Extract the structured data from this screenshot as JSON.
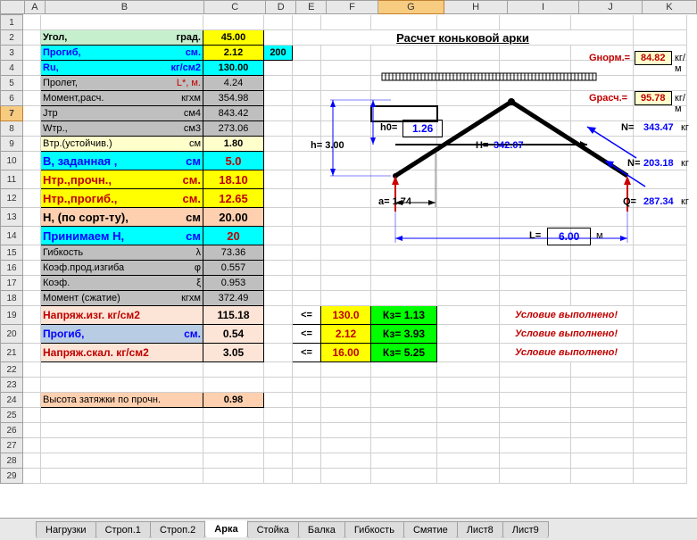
{
  "cols": [
    "A",
    "B",
    "C",
    "D",
    "E",
    "F",
    "G",
    "H",
    "I",
    "J",
    "K"
  ],
  "selCol": "G",
  "selRow": 7,
  "rows": [
    1,
    2,
    3,
    4,
    5,
    6,
    7,
    8,
    9,
    10,
    11,
    12,
    13,
    14,
    15,
    16,
    17,
    18,
    19,
    20,
    21,
    22,
    23,
    24,
    25,
    26,
    27,
    28,
    29
  ],
  "r2": {
    "b": "Угол,",
    "bu": "град.",
    "c": "45.00"
  },
  "r3": {
    "b": "Прогиб,",
    "bu": "см.",
    "c": "2.12",
    "d": "200"
  },
  "r4": {
    "b": "Ru,",
    "bu": "кг/см2",
    "c": "130.00"
  },
  "r5": {
    "b": "Пролет,",
    "bu": "L*, м.",
    "c": "4.24"
  },
  "r6": {
    "b": "Момент,расч.",
    "bu": "кгхм",
    "c": "354.98"
  },
  "r7": {
    "b": "Jтр",
    "bu": "см4",
    "c": "843.42"
  },
  "r8": {
    "b": "Wтp.,",
    "bu": "см3",
    "c": "273.06"
  },
  "r9": {
    "b": "Bтр.(устойчив.)",
    "bu": "см",
    "c": "1.80"
  },
  "r10": {
    "b": "B, заданная ,",
    "bu": "см",
    "c": "5.0"
  },
  "r11": {
    "b": "Hтр.,прочн.,",
    "bu": "см.",
    "c": "18.10"
  },
  "r12": {
    "b": "Hтр.,прогиб.,",
    "bu": "см.",
    "c": "12.65"
  },
  "r13": {
    "b": "H, (по сорт-ту),",
    "bu": "см",
    "c": "20.00"
  },
  "r14": {
    "b": "Принимаем  H,",
    "bu": "см",
    "c": "20"
  },
  "r15": {
    "b": "Гибкость",
    "bu": "λ",
    "c": "73.36"
  },
  "r16": {
    "b": "Коэф.прод.изгиба",
    "bu": "φ",
    "c": "0.557"
  },
  "r17": {
    "b": "Коэф.",
    "bu": "ξ",
    "c": "0.953"
  },
  "r18": {
    "b": "Момент (сжатие)",
    "bu": "кгхм",
    "c": "372.49"
  },
  "r19": {
    "b": "Напряж.изг.  кг/см2",
    "c": "115.18",
    "e": "<=",
    "f": "130.0",
    "g": "Кз= 1.13",
    "cond": "Условие выполнено!"
  },
  "r20": {
    "b": "Прогиб,",
    "bu": "см.",
    "c": "0.54",
    "e": "<=",
    "f": "2.12",
    "g": "Кз= 3.93",
    "cond": "Условие выполнено!"
  },
  "r21": {
    "b": "Напряж.скал. кг/см2",
    "c": "3.05",
    "e": "<=",
    "f": "16.00",
    "g": "Кз= 5.25",
    "cond": "Условие выполнено!"
  },
  "r24": {
    "b": "Высота затяжки по прочн.",
    "c": "0.98"
  },
  "title": "Расчет коньковой арки",
  "diag": {
    "gnorm_l": "Gнорм.=",
    "gnorm_v": "84.82",
    "gunit": "кг/м",
    "grasch_l": "Gрасч.=",
    "grasch_v": "95.78",
    "n1_l": "N=",
    "n1_v": "343.47",
    "nunit": "кг",
    "n2_l": "N=",
    "n2_v": "203.18",
    "q_l": "Q=",
    "q_v": "287.34",
    "h_l": "h=",
    "h_v": "3.00",
    "h0_l": "h0=",
    "h0_v": "1.26",
    "H_l": "H=",
    "H_v": "342.07",
    "a_l": "a=",
    "a_v": "1.74",
    "L_l": "L=",
    "L_v": "6.00",
    "L_u": "м"
  },
  "tabs": [
    "Нагрузки",
    "Строп.1",
    "Строп.2",
    "Арка",
    "Стойка",
    "Балка",
    "Гибкость",
    "Смятие",
    "Лист8",
    "Лист9"
  ],
  "activeTab": "Арка"
}
